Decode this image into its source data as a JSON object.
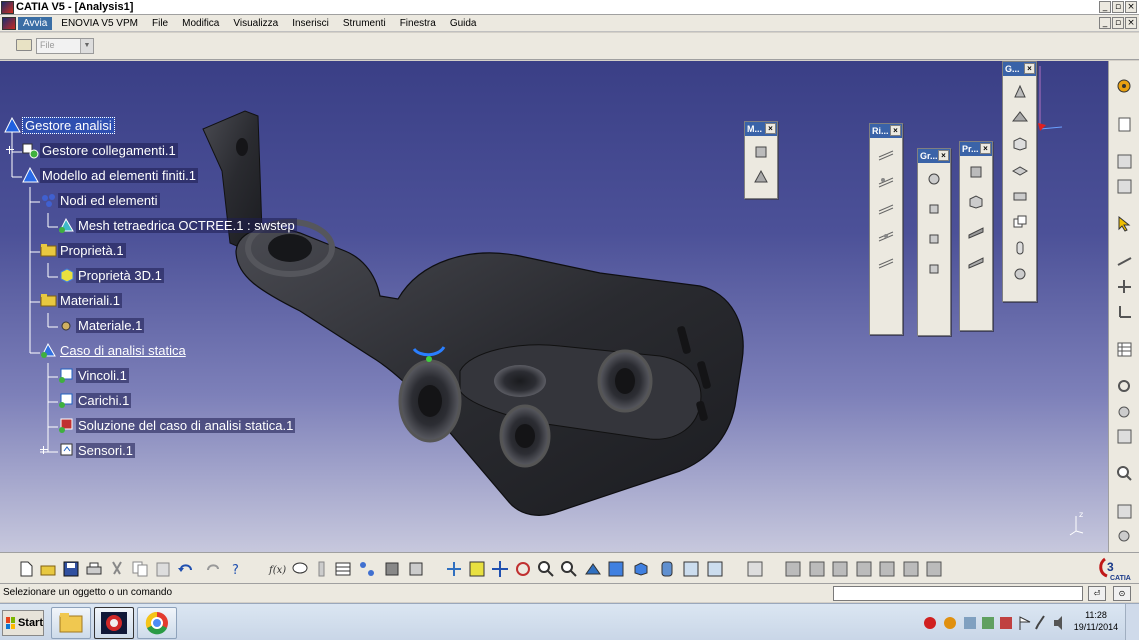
{
  "window": {
    "title": "CATIA V5 - [Analysis1]"
  },
  "menu": {
    "items": [
      {
        "label": "Avvia",
        "active": true
      },
      {
        "label": "ENOVIA V5 VPM"
      },
      {
        "label": "File"
      },
      {
        "label": "Modifica"
      },
      {
        "label": "Visualizza"
      },
      {
        "label": "Inserisci"
      },
      {
        "label": "Strumenti"
      },
      {
        "label": "Finestra"
      },
      {
        "label": "Guida"
      }
    ]
  },
  "toolbar_top": {
    "combo_value": "File"
  },
  "tree": {
    "nodes": [
      {
        "label": "Gestore analisi",
        "level": 0,
        "icon": "analysis-manager-icon",
        "selected": true
      },
      {
        "label": "Gestore collegamenti.1",
        "level": 1,
        "icon": "link-manager-icon"
      },
      {
        "label": "Modello ad elementi finiti.1",
        "level": 1,
        "icon": "fem-model-icon"
      },
      {
        "label": "Nodi ed elementi",
        "level": 2,
        "icon": "nodes-elements-icon"
      },
      {
        "label": "Mesh tetraedrica OCTREE.1 : swstep",
        "level": 3,
        "icon": "octree-mesh-icon"
      },
      {
        "label": "Proprietà.1",
        "level": 2,
        "icon": "properties-folder-icon"
      },
      {
        "label": "Proprietà 3D.1",
        "level": 3,
        "icon": "property-3d-icon"
      },
      {
        "label": "Materiali.1",
        "level": 2,
        "icon": "materials-folder-icon"
      },
      {
        "label": "Materiale.1",
        "level": 3,
        "icon": "material-icon"
      },
      {
        "label": "Caso di analisi statica",
        "level": 2,
        "icon": "static-case-icon",
        "underline": true
      },
      {
        "label": "Vincoli.1",
        "level": 3,
        "icon": "restraints-icon"
      },
      {
        "label": "Carichi.1",
        "level": 3,
        "icon": "loads-icon"
      },
      {
        "label": "Soluzione del caso di analisi statica.1",
        "level": 3,
        "icon": "solution-icon"
      },
      {
        "label": "Sensori.1",
        "level": 3,
        "icon": "sensors-icon"
      }
    ]
  },
  "floating_toolbars": [
    {
      "title": "M...",
      "icons": [
        "mesh-icon",
        "mesh-part-icon"
      ]
    },
    {
      "title": "Ri...",
      "icons": [
        "restraint-clamp-icon",
        "restraint-surface-icon",
        "restraint-slider-icon",
        "restraint-pivot-icon",
        "restraint-ball-icon"
      ]
    },
    {
      "title": "Gr...",
      "icons": [
        "group-points-icon",
        "group-lines-icon",
        "group-surfaces-icon",
        "group-bodies-icon"
      ]
    },
    {
      "title": "Pr...",
      "icons": [
        "property-solid-icon",
        "property-shell-icon",
        "property-beam-icon",
        "property-user-icon"
      ]
    },
    {
      "title": "G...",
      "icons": [
        "geometry-point-icon",
        "geometry-plane-icon",
        "geometry-box-icon",
        "geometry-surface-icon",
        "geometry-face-icon",
        "geometry-copy-icon",
        "geometry-cylinder-icon",
        "geometry-sphere-icon"
      ]
    }
  ],
  "statusbar": {
    "message": "Selezionare un oggetto o un comando"
  },
  "taskbar": {
    "start_label": "Start",
    "time": "11:28",
    "date": "19/11/2014"
  },
  "colors": {
    "viewport_top": "#3a3f86",
    "viewport_bottom": "#c7c8dd",
    "selection": "#2f4fb0",
    "part": "#2b2c31"
  }
}
